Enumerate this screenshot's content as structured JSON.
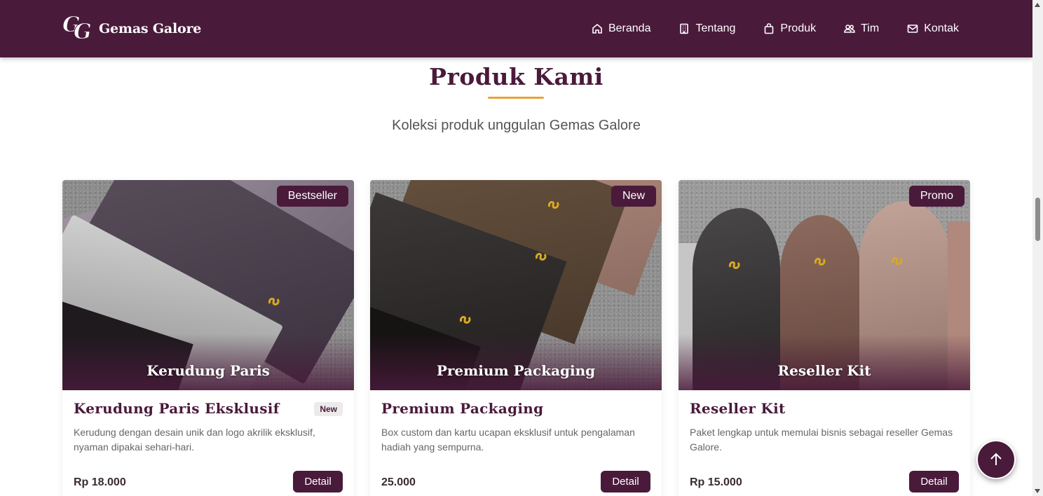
{
  "header": {
    "brand_initials_1": "G",
    "brand_initials_2": "G",
    "brand_name": "Gemas Galore",
    "nav": [
      {
        "label": "Beranda",
        "icon": "home-icon"
      },
      {
        "label": "Tentang",
        "icon": "building-icon"
      },
      {
        "label": "Produk",
        "icon": "shopping-bag-icon"
      },
      {
        "label": "Tim",
        "icon": "users-icon"
      },
      {
        "label": "Kontak",
        "icon": "envelope-icon"
      }
    ]
  },
  "section": {
    "title": "Produk Kami",
    "subtitle": "Koleksi produk unggulan Gemas Galore"
  },
  "products": [
    {
      "badge": "Bestseller",
      "overlay_title": "Kerudung Paris",
      "title": "Kerudung Paris Eksklusif",
      "tag": "New",
      "description": "Kerudung dengan desain unik dan logo akrilik eksklusif, nyaman dipakai sehari-hari.",
      "price": "Rp 18.000",
      "button": "Detail"
    },
    {
      "badge": "New",
      "overlay_title": "Premium Packaging",
      "title": "Premium Packaging",
      "tag": "",
      "description": "Box custom dan kartu ucapan eksklusif untuk pengalaman hadiah yang sempurna.",
      "price": "25.000",
      "button": "Detail"
    },
    {
      "badge": "Promo",
      "overlay_title": "Reseller Kit",
      "title": "Reseller Kit",
      "tag": "",
      "description": "Paket lengkap untuk memulai bisnis sebagai reseller Gemas Galore.",
      "price": "Rp 15.000",
      "button": "Detail"
    }
  ],
  "colors": {
    "primary": "#4a1a3b",
    "accent": "#e8a33c",
    "white": "#ffffff"
  },
  "back_to_top_icon": "arrow-up-icon"
}
